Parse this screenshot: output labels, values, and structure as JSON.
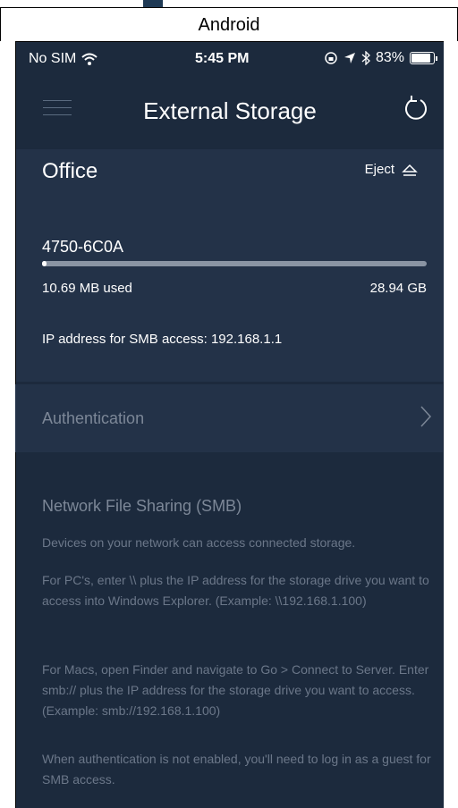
{
  "header_label": "Android",
  "status_bar": {
    "carrier": "No SIM",
    "time": "5:45 PM",
    "battery": "83%"
  },
  "nav": {
    "title": "External Storage"
  },
  "storage": {
    "location": "Office",
    "eject_label": "Eject",
    "device_name": "4750-6C0A",
    "used": "10.69 MB used",
    "total": "28.94 GB",
    "used_fraction": 0.0004,
    "ip_text": "IP address for SMB access: 192.168.1.1"
  },
  "authentication": {
    "label": "Authentication"
  },
  "smb": {
    "title": "Network File Sharing (SMB)",
    "paragraphs": [
      "Devices on your network can access connected storage.",
      "For PC's, enter \\\\ plus the IP address for the storage drive you want to access into Windows Explorer. (Example: \\\\192.168.1.100)",
      "For Macs, open Finder and navigate to Go > Connect to Server. Enter smb:// plus the IP address for the storage drive you want to access. (Example: smb://192.168.1.100)",
      "When authentication is not enabled, you'll need to log in as a guest for SMB access."
    ]
  },
  "colors": {
    "background": "#1c2a3d",
    "panel": "#233248",
    "muted_text": "#7c8797",
    "text": "#ffffff"
  }
}
